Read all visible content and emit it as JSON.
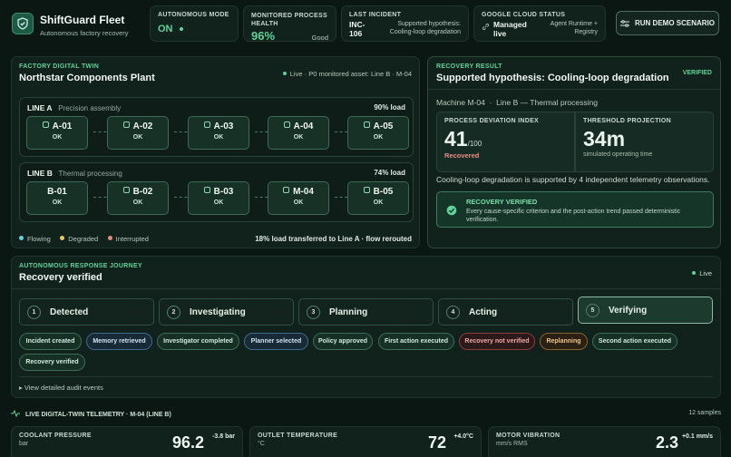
{
  "brand": {
    "title": "ShiftGuard Fleet",
    "subtitle": "Autonomous factory recovery"
  },
  "header": {
    "autonomous_mode": {
      "label": "AUTONOMOUS MODE",
      "value": "ON"
    },
    "monitored": {
      "label": "MONITORED PROCESS HEALTH",
      "value": "96%",
      "status": "Good"
    },
    "last_incident": {
      "label": "LAST INCIDENT",
      "id": "INC-106",
      "text": "Supported hypothesis: Cooling-loop degradation"
    },
    "cloud": {
      "label": "GOOGLE CLOUD STATUS",
      "value": "Managed live",
      "text": "Agent Runtime + Registry"
    },
    "run_button": "RUN DEMO SCENARIO"
  },
  "twin": {
    "label": "FACTORY DIGITAL TWIN",
    "title": "Northstar Components Plant",
    "status": "Live · P0 monitored asset: Line B · M-04",
    "lines": [
      {
        "name": "LINE A",
        "desc": "Precision assembly",
        "load": "90% load",
        "nodes": [
          {
            "id": "A-01",
            "status": "OK"
          },
          {
            "id": "A-02",
            "status": "OK"
          },
          {
            "id": "A-03",
            "status": "OK"
          },
          {
            "id": "A-04",
            "status": "OK"
          },
          {
            "id": "A-05",
            "status": "OK"
          }
        ]
      },
      {
        "name": "LINE B",
        "desc": "Thermal processing",
        "load": "74% load",
        "nodes": [
          {
            "id": "B-01",
            "status": "OK"
          },
          {
            "id": "B-02",
            "status": "OK"
          },
          {
            "id": "B-03",
            "status": "OK"
          },
          {
            "id": "M-04",
            "status": "OK"
          },
          {
            "id": "B-05",
            "status": "OK"
          }
        ]
      }
    ],
    "legend": [
      "Flowing",
      "Degraded",
      "Interrupted"
    ],
    "transfer": "18% load transferred to Line A · flow rerouted"
  },
  "recovery": {
    "label": "RECOVERY RESULT",
    "badge": "VERIFIED",
    "title": "Supported hypothesis: Cooling-loop degradation",
    "machine": "Machine M-04",
    "line": "Line B — Thermal processing",
    "deviation": {
      "label": "PROCESS DEVIATION INDEX",
      "value": "41",
      "unit": "/100",
      "status": "Recovered"
    },
    "threshold": {
      "label": "THRESHOLD PROJECTION",
      "value": "34m",
      "note": "simulated operating time"
    },
    "support": "Cooling-loop degradation is supported by 4 independent telemetry observations.",
    "verified_title": "RECOVERY VERIFIED",
    "verified_text": "Every cause-specific criterion and the post-action trend passed deterministic verification."
  },
  "journey": {
    "label": "AUTONOMOUS RESPONSE JOURNEY",
    "title": "Recovery verified",
    "status": "Live",
    "stages": [
      {
        "n": "1",
        "label": "Detected"
      },
      {
        "n": "2",
        "label": "Investigating"
      },
      {
        "n": "3",
        "label": "Planning"
      },
      {
        "n": "4",
        "label": "Acting"
      },
      {
        "n": "5",
        "label": "Verifying"
      }
    ],
    "events": [
      "Incident created",
      "Memory retrieved",
      "Investigator completed",
      "Planner selected",
      "Policy approved",
      "First action executed",
      "Recovery not verified",
      "Replanning",
      "Second action executed",
      "Recovery verified"
    ],
    "audit": "▸ View detailed audit events"
  },
  "telemetry": {
    "title": "LIVE DIGITAL-TWIN TELEMETRY · M-04 (LINE B)",
    "samples": "12 samples",
    "cards": [
      {
        "label": "COOLANT PRESSURE",
        "unit": "bar",
        "value": "96.2",
        "delta": "-3.8 bar"
      },
      {
        "label": "OUTLET TEMPERATURE",
        "unit": "°C",
        "value": "72",
        "delta": "+4.0°C"
      },
      {
        "label": "MOTOR VIBRATION",
        "unit": "mm/s RMS",
        "value": "2.3",
        "delta": "+0.1 mm/s"
      }
    ]
  },
  "colors": {
    "accent": "#5fd39a",
    "danger": "#f0a7a7",
    "warning": "#f1c58c",
    "info": "#cfe2f2"
  }
}
